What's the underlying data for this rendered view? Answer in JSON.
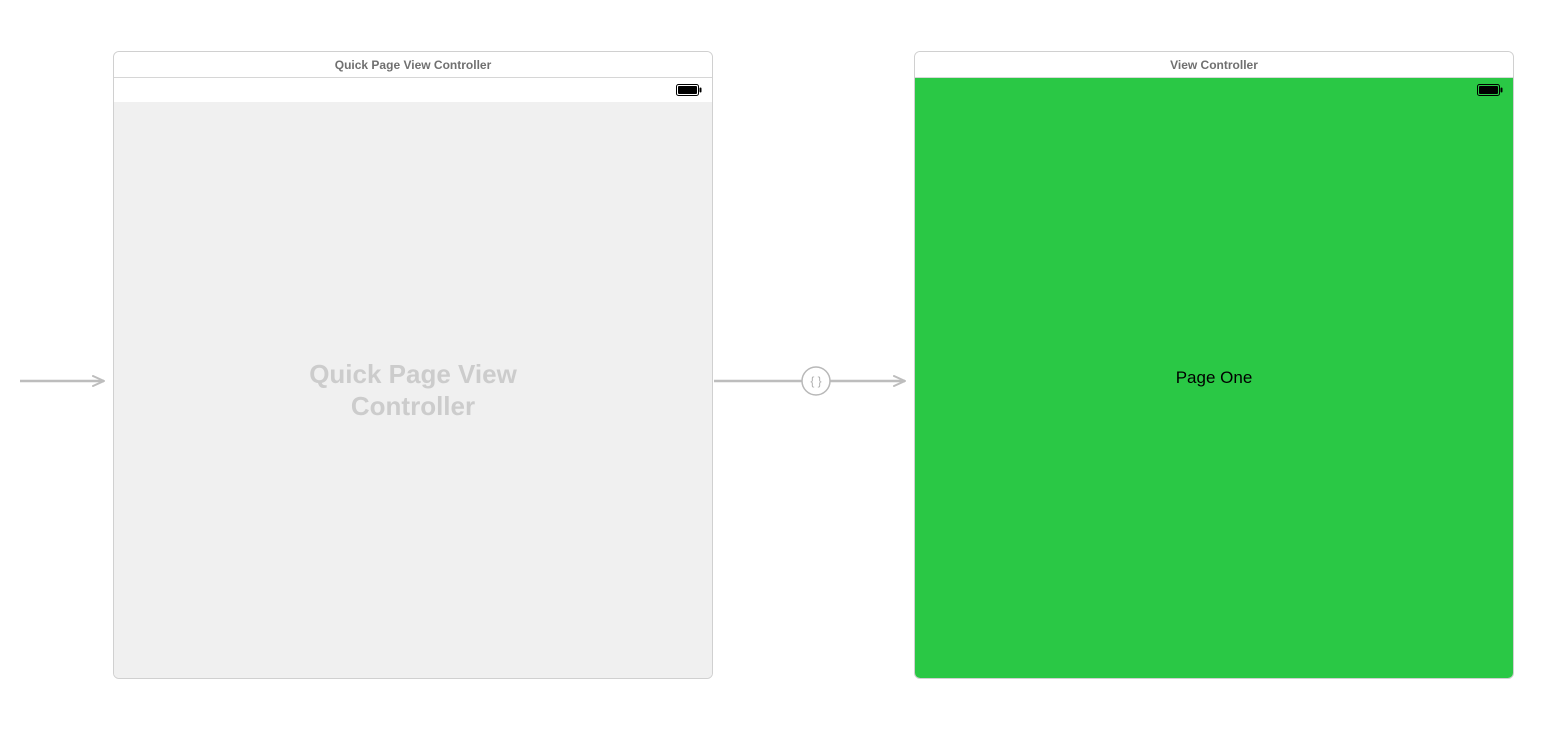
{
  "colors": {
    "arrow": "#bdbdbd",
    "scene_border": "#d0d0d0",
    "title_text": "#707070",
    "placeholder": "#cccccc",
    "right_bg": "#2ac845",
    "battery_dark": "#000000"
  },
  "scenes": {
    "left": {
      "title": "Quick Page View Controller",
      "placeholder": "Quick Page View\nController",
      "body_bg": "#f0f0f0"
    },
    "right": {
      "title": "View Controller",
      "label": "Page One",
      "body_bg": "#2ac845"
    }
  },
  "segue": {
    "glyph": "{ }"
  }
}
